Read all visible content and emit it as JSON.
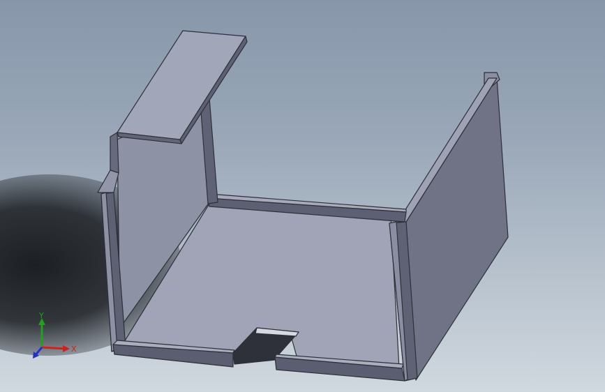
{
  "viewport": {
    "background_top": "#8797a9",
    "background_bottom": "#d0d8df"
  },
  "model": {
    "face_light": "#a3a7b9",
    "face_mid": "#8f93a6",
    "face_dark": "#6c6f82",
    "edge": "#2d2f38"
  },
  "triad": {
    "x_label": "X",
    "y_label": "Y",
    "x_color": "#d02020",
    "y_color": "#20a020",
    "z_color": "#2030c8"
  }
}
